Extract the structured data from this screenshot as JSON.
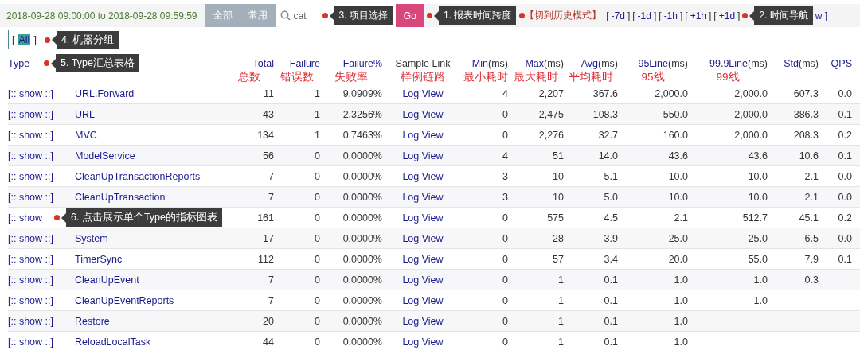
{
  "toolbar": {
    "time_range": "2018-09-28 09:00:00 to 2018-09-28 09:59:59",
    "scope_tabs": [
      {
        "label": "全部",
        "selected": false
      },
      {
        "label": "常用",
        "selected": false
      }
    ],
    "search": {
      "value": "cat"
    },
    "go_button": "Go",
    "history_link": "【切到历史模式】",
    "time_nav": [
      {
        "label": "-7d"
      },
      {
        "label": "-1d"
      },
      {
        "label": "-1h"
      },
      {
        "label": "+1h"
      },
      {
        "label": "+1d"
      }
    ],
    "time_nav_tail": "w ]",
    "bracket_open": "[",
    "bracket_close": "]"
  },
  "callouts": [
    "3. 项目选择",
    "1. 报表时间跨度",
    "2. 时间导航",
    "4. 机器分组",
    "5. Type汇总表格"
  ],
  "machine_groups": [
    {
      "label": "All",
      "selected": true
    }
  ],
  "table": {
    "columns": [
      {
        "name": "Type"
      },
      {},
      {
        "name": "Total",
        "note": "总数"
      },
      {
        "name": "Failure",
        "note": "错误数"
      },
      {
        "name": "Failure%",
        "note": "失败率"
      },
      {
        "name": "Sample Link",
        "note": "样例链路"
      },
      {
        "name": "Min",
        "unit": "(ms)",
        "note": "最小耗时"
      },
      {
        "name": "Max",
        "unit": "(ms)",
        "note": "最大耗时"
      },
      {
        "name": "Avg",
        "unit": "(ms)",
        "note": "平均耗时"
      },
      {
        "name": "95Line",
        "unit": "(ms)",
        "note": "95线"
      },
      {
        "name": "99.9Line",
        "unit": "(ms)",
        "note": "99线"
      },
      {
        "name": "Std",
        "unit": "(ms)"
      },
      {
        "name": "QPS"
      }
    ],
    "rows": [
      {
        "cells": [
          "[:: show ::]",
          "URL.Forward",
          "11",
          "1",
          "9.0909%",
          "Log View",
          "4",
          "2,207",
          "367.6",
          "2,000.0",
          "2,000.0",
          "607.3",
          "0.0"
        ]
      },
      {
        "cells": [
          "[:: show ::]",
          "URL",
          "43",
          "1",
          "2.3256%",
          "Log View",
          "0",
          "2,475",
          "108.3",
          "550.0",
          "2,000.0",
          "386.3",
          "0.1"
        ]
      },
      {
        "cells": [
          "[:: show ::]",
          "MVC",
          "134",
          "1",
          "0.7463%",
          "Log View",
          "0",
          "2,276",
          "32.7",
          "160.0",
          "2,000.0",
          "208.3",
          "0.2"
        ]
      },
      {
        "cells": [
          "[:: show ::]",
          "ModelService",
          "56",
          "0",
          "0.0000%",
          "Log View",
          "4",
          "51",
          "14.0",
          "43.6",
          "43.6",
          "10.6",
          "0.1"
        ]
      },
      {
        "cells": [
          "[:: show ::]",
          "CleanUpTransactionReports",
          "7",
          "0",
          "0.0000%",
          "Log View",
          "3",
          "10",
          "5.1",
          "10.0",
          "10.0",
          "2.1",
          "0.0"
        ]
      },
      {
        "cells": [
          "[:: show ::]",
          "CleanUpTransaction",
          "7",
          "0",
          "0.0000%",
          "Log View",
          "3",
          "10",
          "5.0",
          "10.0",
          "10.0",
          "2.1",
          "0.0"
        ]
      },
      {
        "cells": [
          "[:: show",
          "",
          "161",
          "0",
          "0.0000%",
          "Log View",
          "0",
          "575",
          "4.5",
          "2.1",
          "512.7",
          "45.1",
          "0.2"
        ],
        "callout": "6. 点击展示单个Type的指标图表"
      },
      {
        "cells": [
          "[:: show ::]",
          "System",
          "17",
          "0",
          "0.0000%",
          "Log View",
          "0",
          "28",
          "3.9",
          "25.0",
          "25.0",
          "6.5",
          "0.0"
        ]
      },
      {
        "cells": [
          "[:: show ::]",
          "TimerSync",
          "112",
          "0",
          "0.0000%",
          "Log View",
          "0",
          "57",
          "3.4",
          "20.0",
          "55.0",
          "7.9",
          "0.1"
        ]
      },
      {
        "cells": [
          "[:: show ::]",
          "CleanUpEvent",
          "7",
          "0",
          "0.0000%",
          "Log View",
          "0",
          "1",
          "0.1",
          "1.0",
          "1.0",
          "0.3",
          ""
        ]
      },
      {
        "cells": [
          "[:: show ::]",
          "CleanUpEventReports",
          "7",
          "0",
          "0.0000%",
          "Log View",
          "0",
          "1",
          "0.1",
          "1.0",
          "1.0",
          "",
          ""
        ]
      },
      {
        "cells": [
          "[:: show ::]",
          "Restore",
          "20",
          "0",
          "0.0000%",
          "Log View",
          "0",
          "1",
          "0.1",
          "1.0",
          "",
          "",
          ""
        ]
      },
      {
        "cells": [
          "[:: show ::]",
          "ReloadLocalTask",
          "44",
          "0",
          "0.0000%",
          "Log View",
          "0",
          "1",
          "0.1",
          "1.0",
          "",
          "",
          ""
        ]
      }
    ]
  }
}
